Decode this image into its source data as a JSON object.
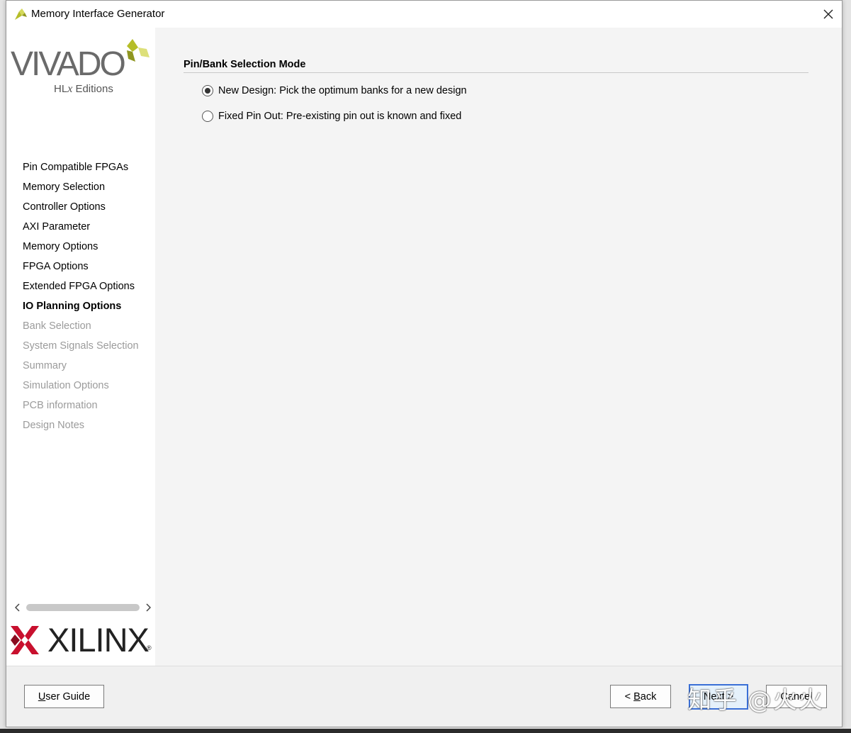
{
  "window": {
    "title": "Memory Interface Generator"
  },
  "logos": {
    "vivado_word": "VIVADO",
    "vivado_edition_prefix": "HL",
    "vivado_edition_x": "x",
    "vivado_edition_suffix": " Editions",
    "xilinx_word": "XILINX",
    "xilinx_reg": "®"
  },
  "sidebar": {
    "steps": [
      {
        "label": "Pin Compatible FPGAs",
        "state": "done"
      },
      {
        "label": "Memory Selection",
        "state": "done"
      },
      {
        "label": "Controller Options",
        "state": "done"
      },
      {
        "label": "AXI Parameter",
        "state": "done"
      },
      {
        "label": "Memory Options",
        "state": "done"
      },
      {
        "label": "FPGA Options",
        "state": "done"
      },
      {
        "label": "Extended FPGA Options",
        "state": "done"
      },
      {
        "label": "IO Planning Options",
        "state": "current"
      },
      {
        "label": "Bank Selection",
        "state": "pending"
      },
      {
        "label": "System Signals Selection",
        "state": "pending"
      },
      {
        "label": "Summary",
        "state": "pending"
      },
      {
        "label": "Simulation Options",
        "state": "pending"
      },
      {
        "label": "PCB information",
        "state": "pending"
      },
      {
        "label": "Design Notes",
        "state": "pending"
      }
    ]
  },
  "main": {
    "section_title": "Pin/Bank Selection Mode",
    "options": [
      {
        "label": "New Design: Pick the optimum banks for a new design",
        "selected": true
      },
      {
        "label": "Fixed Pin Out: Pre-existing pin out is known and fixed",
        "selected": false
      }
    ]
  },
  "footer": {
    "user_guide_accel": "U",
    "user_guide_rest": "ser Guide",
    "back_prefix": "< ",
    "back_accel": "B",
    "back_rest": "ack",
    "next_label": "Next >",
    "cancel_label": "Cancel"
  },
  "overlay": {
    "watermark": "知乎 @火火"
  },
  "colors": {
    "vivado_green": "#b5bd28",
    "xilinx_red": "#c8102e",
    "primary_border": "#3a6fd6"
  }
}
